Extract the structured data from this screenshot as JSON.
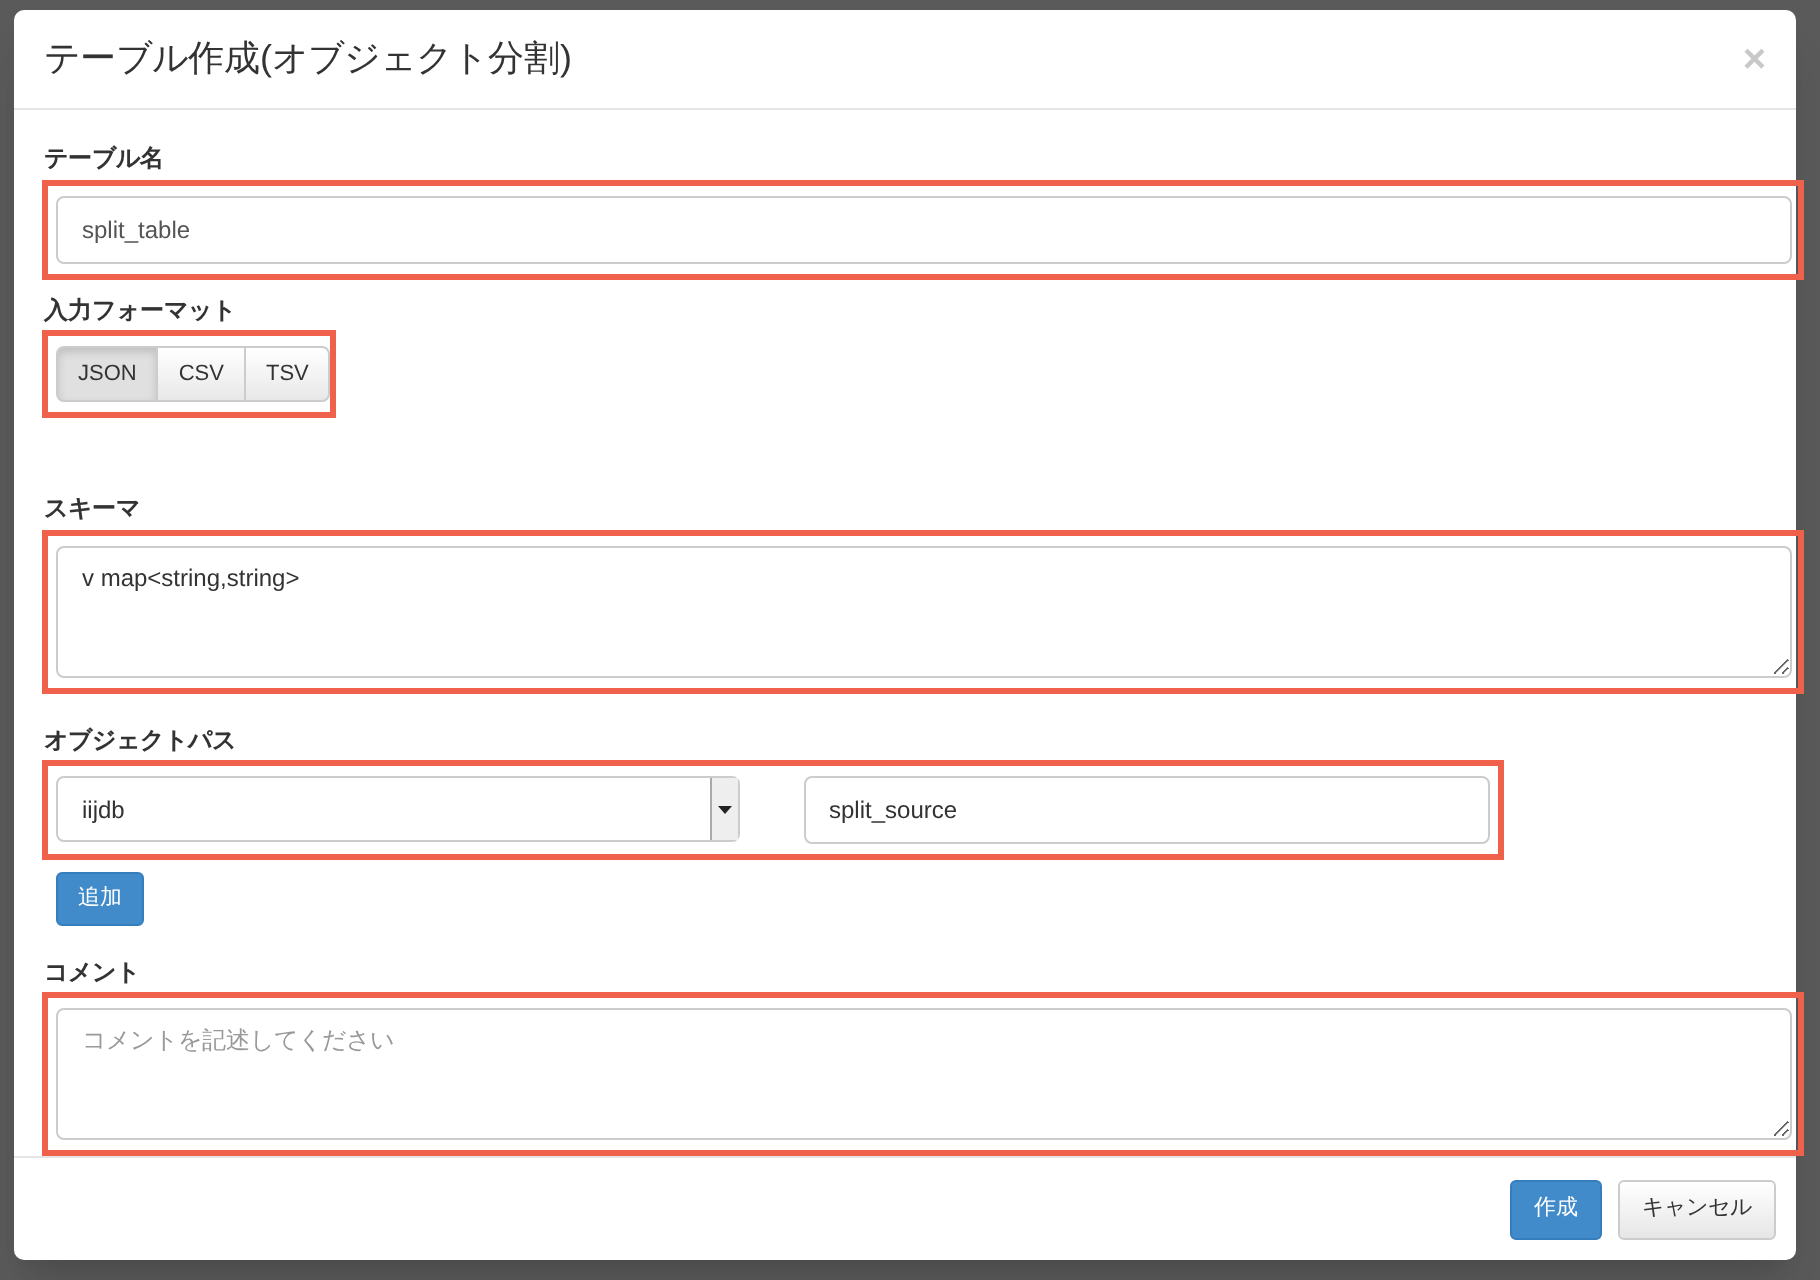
{
  "dialog": {
    "title": "テーブル作成(オブジェクト分割)",
    "close": "×"
  },
  "table_name": {
    "label": "テーブル名",
    "value": "split_table",
    "highlighted": true
  },
  "input_format": {
    "label": "入力フォーマット",
    "highlighted": true,
    "options": [
      {
        "label": "JSON",
        "selected": true
      },
      {
        "label": "CSV",
        "selected": false
      },
      {
        "label": "TSV",
        "selected": false
      }
    ]
  },
  "schema": {
    "label": "スキーマ",
    "value": "v map<string,string>",
    "highlighted": true
  },
  "object_path": {
    "label": "オブジェクトパス",
    "highlighted": true,
    "database": "iijdb",
    "path": "split_source",
    "add_button": "追加"
  },
  "comment": {
    "label": "コメント",
    "placeholder": "コメントを記述してください",
    "highlighted": true
  },
  "buttons": [
    {
      "label": "作成",
      "kind": "primary"
    },
    {
      "label": "キャンセル",
      "kind": "default"
    }
  ]
}
